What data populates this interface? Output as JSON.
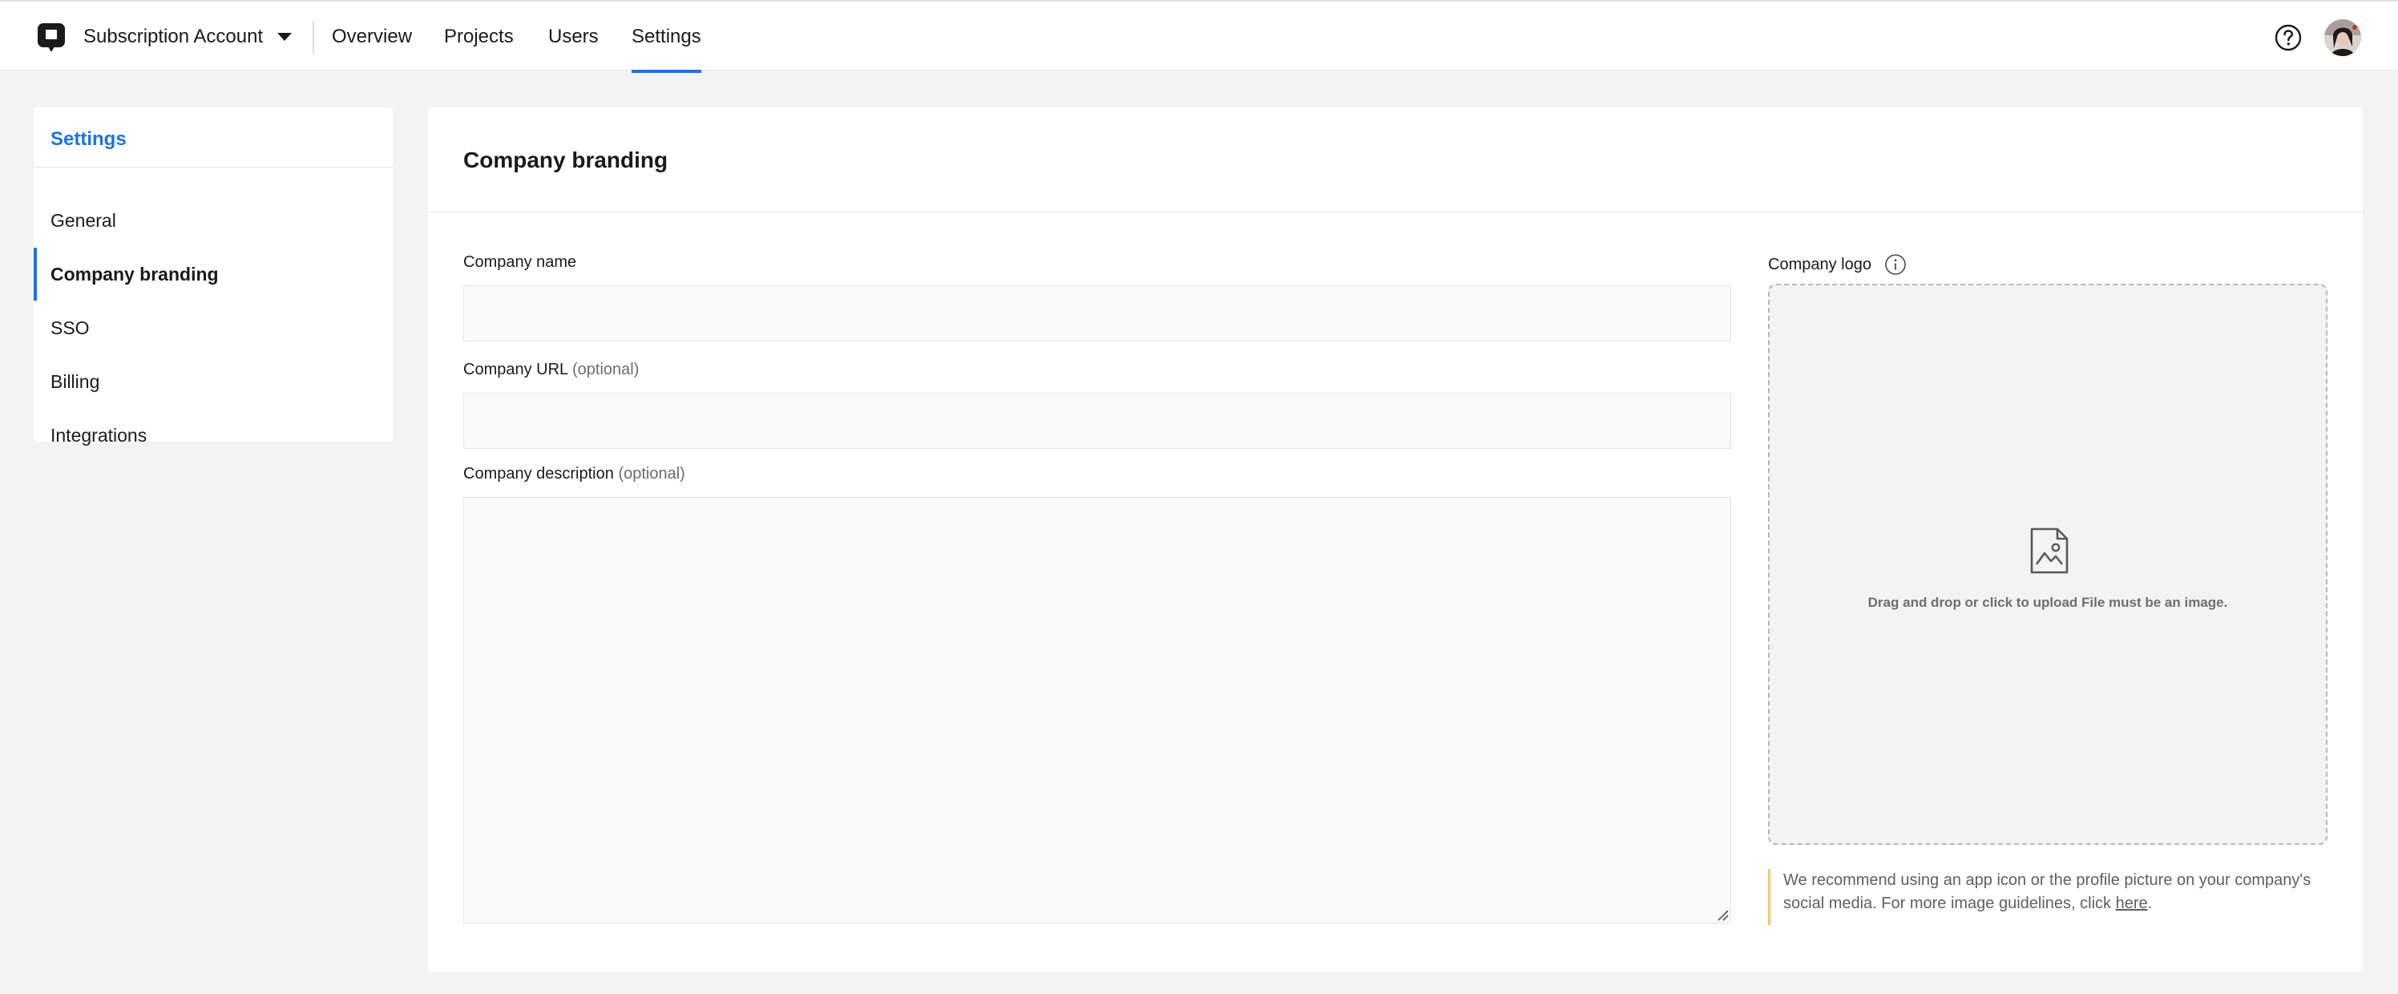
{
  "header": {
    "account_name": "Subscription Account",
    "nav": [
      {
        "label": "Overview",
        "active": false
      },
      {
        "label": "Projects",
        "active": false
      },
      {
        "label": "Users",
        "active": false
      },
      {
        "label": "Settings",
        "active": true
      }
    ],
    "help_icon": "help-circle-icon",
    "accent_color": "#1a73e8"
  },
  "sidebar": {
    "title": "Settings",
    "items": [
      {
        "label": "General",
        "active": false
      },
      {
        "label": "Company branding",
        "active": true
      },
      {
        "label": "SSO",
        "active": false
      },
      {
        "label": "Billing",
        "active": false
      },
      {
        "label": "Integrations",
        "active": false
      }
    ]
  },
  "main": {
    "title": "Company branding",
    "company_name": {
      "label": "Company name",
      "value": ""
    },
    "company_url": {
      "label": "Company URL",
      "optional": "(optional)",
      "value": ""
    },
    "company_description": {
      "label": "Company description",
      "optional": "(optional)",
      "value": ""
    },
    "logo": {
      "label": "Company logo",
      "info_icon": "info-icon",
      "upload_icon": "file-image-icon",
      "dropzone_text": "Drag and drop or click to upload File must be an image.",
      "hint_text": "We recommend using an app icon or the profile picture on your company's social media. For more image guidelines, click ",
      "hint_link": "here",
      "hint_end": "."
    }
  }
}
